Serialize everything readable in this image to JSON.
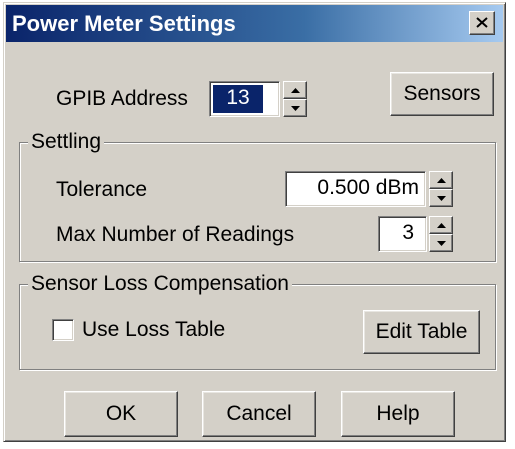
{
  "window": {
    "title": "Power Meter Settings",
    "close_icon": "close-icon"
  },
  "gpib": {
    "label": "GPIB Address",
    "value": "13"
  },
  "sensors_button": "Sensors",
  "settling": {
    "legend": "Settling",
    "tolerance_label": "Tolerance",
    "tolerance_value": "0.500 dBm",
    "max_readings_label": "Max Number of Readings",
    "max_readings_value": "3"
  },
  "loss_comp": {
    "legend": "Sensor Loss Compensation",
    "use_loss_table_label": "Use Loss Table",
    "use_loss_table_checked": false,
    "edit_table_button": "Edit Table"
  },
  "footer": {
    "ok": "OK",
    "cancel": "Cancel",
    "help": "Help"
  },
  "colors": {
    "title_start": "#0a246a",
    "title_end": "#a6caf0",
    "face": "#d4d0c8",
    "selection": "#0a246a"
  }
}
